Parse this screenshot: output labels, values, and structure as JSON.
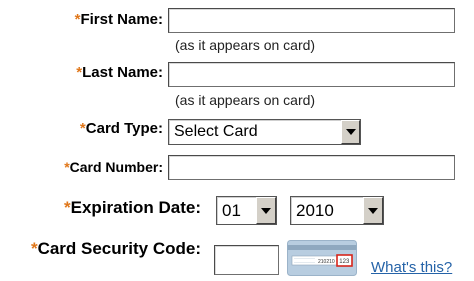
{
  "form": {
    "required_marker": "*",
    "first_name": {
      "label": "First Name:",
      "value": "",
      "hint": "(as it appears on card)"
    },
    "last_name": {
      "label": "Last Name:",
      "value": "",
      "hint": "(as it appears on card)"
    },
    "card_type": {
      "label": "Card Type:",
      "selected": "Select Card"
    },
    "card_number": {
      "label": "Card Number:",
      "value": ""
    },
    "expiration": {
      "label": "Expiration Date:",
      "month": "01",
      "year": "2010"
    },
    "security_code": {
      "label": "Card Security Code:",
      "value": "",
      "help_link": "What's this?",
      "card_sample_number": "210210",
      "card_sample_cvv": "123"
    }
  },
  "colors": {
    "required_marker": "#e0771a",
    "link": "#2563a8",
    "card_graphic": "#b8cde0",
    "cvv_highlight": "#d6261c"
  }
}
